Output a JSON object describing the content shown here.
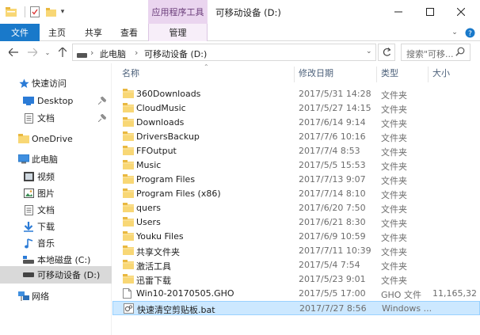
{
  "window": {
    "title": "可移动设备 (D:)",
    "context_tab": "应用程序工具",
    "controls": {
      "minimize": "—",
      "maximize": "☐",
      "close": "✕"
    }
  },
  "ribbon": {
    "tabs": [
      "文件",
      "主页",
      "共享",
      "查看",
      "管理"
    ],
    "collapse_icon": "chevron-down-icon",
    "help_icon": "help-icon"
  },
  "address": {
    "crumbs": [
      "此电脑",
      "可移动设备 (D:)"
    ],
    "search_placeholder": "搜索\"可移...",
    "colors": {
      "accent": "#1979ca",
      "folder": "#f8d775",
      "selection": "#cce8ff"
    }
  },
  "sidebar": {
    "quick_access": "快速访问",
    "pinned": [
      "Desktop",
      "文档"
    ],
    "onedrive": "OneDrive",
    "this_pc": "此电脑",
    "pc_items": [
      "视频",
      "图片",
      "文档",
      "下载",
      "音乐",
      "本地磁盘 (C:)",
      "可移动设备 (D:)"
    ],
    "network": "网络"
  },
  "columns": {
    "name": "名称",
    "date": "修改日期",
    "type": "类型",
    "size": "大小"
  },
  "files": [
    {
      "name": "360Downloads",
      "date": "2017/5/31 14:28",
      "type": "文件夹",
      "size": "",
      "kind": "folder"
    },
    {
      "name": "CloudMusic",
      "date": "2017/5/27 14:15",
      "type": "文件夹",
      "size": "",
      "kind": "folder"
    },
    {
      "name": "Downloads",
      "date": "2017/6/14 9:14",
      "type": "文件夹",
      "size": "",
      "kind": "folder"
    },
    {
      "name": "DriversBackup",
      "date": "2017/7/6 10:16",
      "type": "文件夹",
      "size": "",
      "kind": "folder"
    },
    {
      "name": "FFOutput",
      "date": "2017/7/4 8:53",
      "type": "文件夹",
      "size": "",
      "kind": "folder"
    },
    {
      "name": "Music",
      "date": "2017/5/5 15:53",
      "type": "文件夹",
      "size": "",
      "kind": "folder"
    },
    {
      "name": "Program Files",
      "date": "2017/7/13 9:07",
      "type": "文件夹",
      "size": "",
      "kind": "folder"
    },
    {
      "name": "Program Files (x86)",
      "date": "2017/7/14 8:10",
      "type": "文件夹",
      "size": "",
      "kind": "folder"
    },
    {
      "name": "quers",
      "date": "2017/6/20 7:50",
      "type": "文件夹",
      "size": "",
      "kind": "folder"
    },
    {
      "name": "Users",
      "date": "2017/6/21 8:30",
      "type": "文件夹",
      "size": "",
      "kind": "folder"
    },
    {
      "name": "Youku Files",
      "date": "2017/6/9 10:59",
      "type": "文件夹",
      "size": "",
      "kind": "folder"
    },
    {
      "name": "共享文件夹",
      "date": "2017/7/11 10:39",
      "type": "文件夹",
      "size": "",
      "kind": "folder"
    },
    {
      "name": "激活工具",
      "date": "2017/5/4 7:54",
      "type": "文件夹",
      "size": "",
      "kind": "folder"
    },
    {
      "name": "迅雷下载",
      "date": "2017/5/23 9:01",
      "type": "文件夹",
      "size": "",
      "kind": "folder"
    },
    {
      "name": "Win10-20170505.GHO",
      "date": "2017/5/5 17:00",
      "type": "GHO 文件",
      "size": "11,165,32",
      "kind": "file"
    },
    {
      "name": "快速清空剪贴板.bat",
      "date": "2017/7/27 8:56",
      "type": "Windows ...",
      "size": "",
      "kind": "bat",
      "selected": true
    }
  ]
}
